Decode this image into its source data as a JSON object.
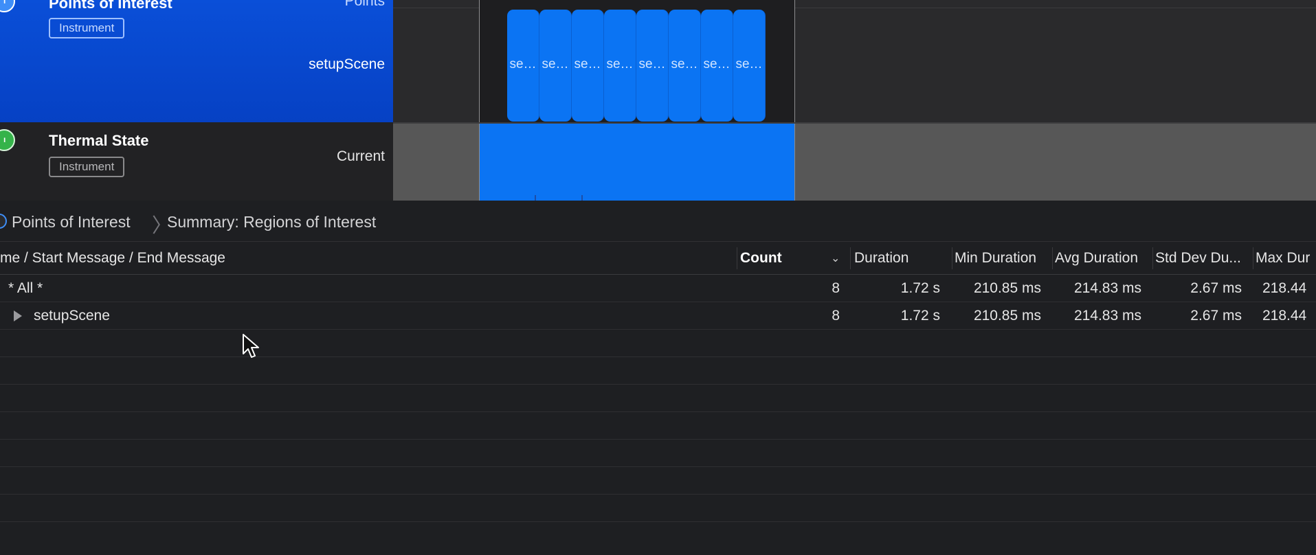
{
  "tracks": {
    "points_of_interest": {
      "title": "Points of Interest",
      "badge": "Instrument",
      "lane_top_label": "Points",
      "lane_label": "setupScene",
      "regions": [
        "se…",
        "se…",
        "se…",
        "se…",
        "se…",
        "se…",
        "se…",
        "se…"
      ]
    },
    "thermal_state": {
      "title": "Thermal State",
      "badge": "Instrument",
      "lane_label": "Current"
    }
  },
  "breadcrumb": {
    "instrument": "Points of Interest",
    "view": "Summary: Regions of Interest"
  },
  "table": {
    "columns": {
      "name": "me / Start Message / End Message",
      "count": "Count",
      "duration": "Duration",
      "min": "Min Duration",
      "avg": "Avg Duration",
      "std": "Std Dev Du...",
      "max": "Max Dur"
    },
    "sorted_column": "count",
    "rows": [
      {
        "name": "* All *",
        "count": "8",
        "duration": "1.72 s",
        "min": "210.85 ms",
        "avg": "214.83 ms",
        "std": "2.67 ms",
        "max": "218.44"
      },
      {
        "name": "setupScene",
        "count": "8",
        "duration": "1.72 s",
        "min": "210.85 ms",
        "avg": "214.83 ms",
        "std": "2.67 ms",
        "max": "218.44"
      }
    ]
  },
  "colors": {
    "accent": "#0b74f3",
    "track_header": "#0641c4",
    "thermal_icon": "#35b34a"
  },
  "icons": {
    "poi_track": "points-of-interest-icon",
    "thermal_track": "thermometer-icon",
    "expand": "disclosure-triangle-icon",
    "sort": "chevron-down-icon",
    "pointer": "mouse-cursor-icon"
  }
}
